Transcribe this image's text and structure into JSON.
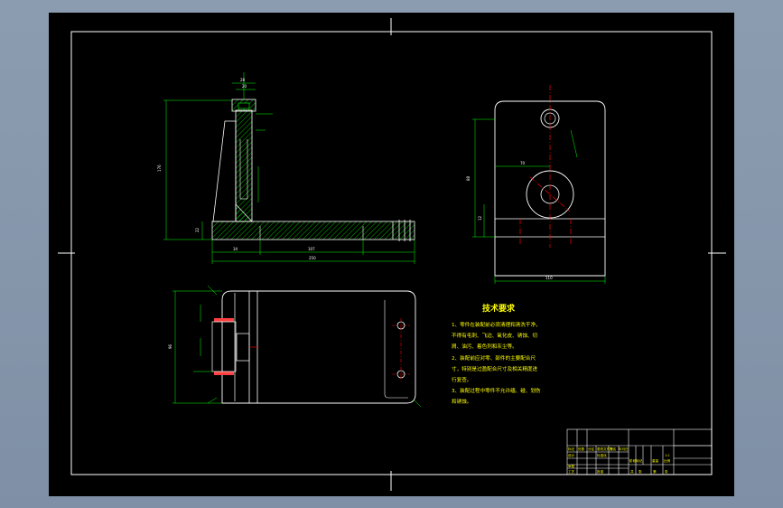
{
  "drawing": {
    "background": "#000000",
    "colors": {
      "outline": "#ffffff",
      "part": "#00ff00",
      "centerline": "#ff0000",
      "dimension": "#00ff00",
      "text": "#ffff00"
    }
  },
  "front_view": {
    "dims": {
      "top_width": "20",
      "upper_width": "28",
      "total_height": "176",
      "base_height": "22",
      "base_offset": "34",
      "slot_length": "107",
      "total_length": "250"
    }
  },
  "side_view": {
    "dims": {
      "height": "88",
      "lower": "12",
      "offset": "70",
      "width": "110"
    }
  },
  "top_view": {
    "dims": {
      "depth": "96"
    }
  },
  "technical_requirements": {
    "title": "技术要求",
    "lines": [
      "1、零件在装配前必须清理和清洗干净，",
      "不得有毛刺、飞边、氧化皮、锈蚀、切",
      "屑、油污、着色剂和灰尘等。",
      "2、装配前应对零、部件的主要配合尺",
      "寸，特别是过盈配合尺寸及相关精度进",
      "行复查。",
      "3、装配过程中零件不允许磕、碰、划伤",
      "和锈蚀。"
    ]
  },
  "title_block": {
    "cells": [
      "标记",
      "处数",
      "分区",
      "更改文件号",
      "签名",
      "年月日",
      "设计",
      "标准化",
      "阶段标记",
      "重量",
      "比例",
      "审核",
      "工艺",
      "批准",
      "共",
      "张",
      "第",
      "张",
      "1:1"
    ]
  }
}
